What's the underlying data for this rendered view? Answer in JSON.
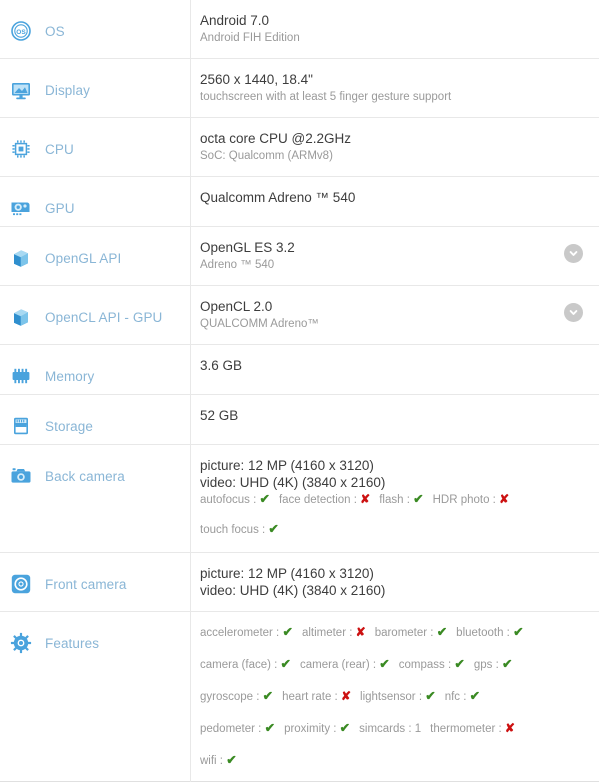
{
  "colors": {
    "label": "#8ab6d6",
    "icon": "#4aa3dd",
    "value": "#3d3d3d",
    "secondary": "#9a9a9a",
    "yes": "#3a8a23",
    "no": "#cc1111",
    "border": "#e8e8e8",
    "expander_bg": "#c9c9c9"
  },
  "glyphs": {
    "yes": "✔",
    "no": "✘"
  },
  "rows": [
    {
      "icon": "os-icon",
      "label": "OS",
      "primary": "Android 7.0",
      "secondary": "Android FIH Edition"
    },
    {
      "icon": "display-icon",
      "label": "Display",
      "primary": "2560 x 1440, 18.4\"",
      "secondary": "touchscreen with at least 5 finger gesture support"
    },
    {
      "icon": "cpu-icon",
      "label": "CPU",
      "primary": "octa core CPU @2.2GHz",
      "secondary": "SoC: Qualcomm (ARMv8)"
    },
    {
      "icon": "gpu-icon",
      "label": "GPU",
      "primary": "Qualcomm Adreno ™ 540",
      "secondary": ""
    },
    {
      "icon": "cube-icon",
      "label": "OpenGL API",
      "primary": "OpenGL ES 3.2",
      "secondary": "Adreno ™ 540",
      "expander": "chevron-down-icon"
    },
    {
      "icon": "cube-icon",
      "label": "OpenCL API - GPU",
      "primary": "OpenCL 2.0",
      "secondary": "QUALCOMM Adreno™",
      "expander": "chevron-down-icon"
    },
    {
      "icon": "memory-icon",
      "label": "Memory",
      "primary": "3.6 GB",
      "secondary": ""
    },
    {
      "icon": "storage-icon",
      "label": "Storage",
      "primary": "52 GB",
      "secondary": ""
    }
  ],
  "back_camera": {
    "icon": "back-camera-icon",
    "label": "Back camera",
    "picture": "picture: 12 MP (4160 x 3120)",
    "video": "video: UHD (4K) (3840 x 2160)",
    "features_row1": [
      {
        "name": "autofocus",
        "sep": ":",
        "value": "yes"
      },
      {
        "name": "face detection",
        "sep": ":",
        "value": "no"
      },
      {
        "name": "flash",
        "sep": ":",
        "value": "yes"
      },
      {
        "name": "HDR photo",
        "sep": ":",
        "value": "no"
      }
    ],
    "features_row2": [
      {
        "name": "touch focus",
        "sep": ":",
        "value": "yes"
      }
    ]
  },
  "front_camera": {
    "icon": "front-camera-icon",
    "label": "Front camera",
    "picture": "picture: 12 MP (4160 x 3120)",
    "video": "video: UHD (4K) (3840 x 2160)"
  },
  "features": {
    "icon": "features-gear-icon",
    "label": "Features",
    "lines": [
      [
        {
          "name": "accelerometer",
          "sep": ":",
          "value": "yes"
        },
        {
          "name": "altimeter",
          "sep": ":",
          "value": "no"
        },
        {
          "name": "barometer",
          "sep": ":",
          "value": "yes"
        },
        {
          "name": "bluetooth",
          "sep": ":",
          "value": "yes"
        }
      ],
      [
        {
          "name": "camera (face)",
          "sep": ":",
          "value": "yes"
        },
        {
          "name": "camera (rear)",
          "sep": ":",
          "value": "yes"
        },
        {
          "name": "compass",
          "sep": ":",
          "value": "yes"
        },
        {
          "name": "gps",
          "sep": ":",
          "value": "yes"
        }
      ],
      [
        {
          "name": "gyroscope",
          "sep": ":",
          "value": "yes"
        },
        {
          "name": "heart rate",
          "sep": ":",
          "value": "no"
        },
        {
          "name": "lightsensor",
          "sep": ":",
          "value": "yes"
        },
        {
          "name": "nfc",
          "sep": ":",
          "value": "yes"
        }
      ],
      [
        {
          "name": "pedometer",
          "sep": ":",
          "value": "yes"
        },
        {
          "name": "proximity",
          "sep": ":",
          "value": "yes"
        },
        {
          "name": "simcards",
          "sep": ":",
          "value": "1"
        },
        {
          "name": "thermometer",
          "sep": ":",
          "value": "no"
        }
      ],
      [
        {
          "name": "wifi",
          "sep": ":",
          "value": "yes"
        }
      ]
    ]
  }
}
